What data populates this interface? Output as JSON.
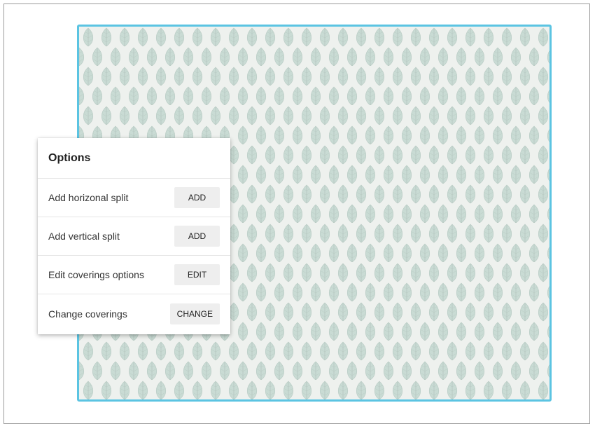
{
  "canvas": {
    "border_color": "#5bc4e2",
    "pattern": "leaf-wallpaper-icon",
    "pattern_colors": {
      "background": "#eef1ee",
      "leaf": "#c9dbd4",
      "vein": "#aebfb8"
    }
  },
  "options": {
    "title": "Options",
    "items": [
      {
        "label": "Add horizonal split",
        "button": "ADD"
      },
      {
        "label": "Add vertical split",
        "button": "ADD"
      },
      {
        "label": "Edit coverings options",
        "button": "EDIT"
      },
      {
        "label": "Change coverings",
        "button": "CHANGE"
      }
    ]
  }
}
